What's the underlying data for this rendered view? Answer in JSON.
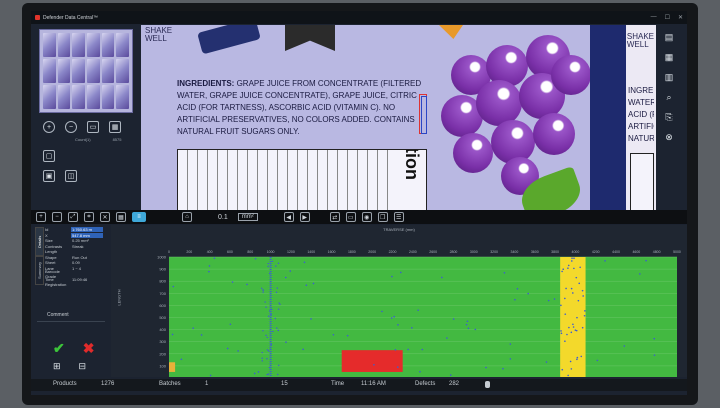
{
  "app": {
    "title": "Defender Data Central™"
  },
  "window": {
    "min": "—",
    "max": "☐",
    "close": "✕"
  },
  "label": {
    "shake_left": [
      "SHAKE",
      "WELL"
    ],
    "shake_right": [
      "SHAKE",
      "WELL"
    ],
    "ingredients_bold": "INGREDIENTS:",
    "ingredients_text": " GRAPE JUICE FROM CONCENTRATE (FILTERED WATER, GRAPE JUICE CONCENTRATE), GRAPE JUICE, CITRIC ACID (FOR TARTNESS), ASCORBIC ACID (VITAMIN C). NO ARTIFICIAL PRESERVATIVES, NO COLORS ADDED. CONTAINS NATURAL FRUIT SUGARS ONLY.",
    "right_col": [
      "INGREDIENTS",
      "WATER, GRAPE J",
      "ACID (FOR T",
      "ARTIFICIAL PRE",
      "NATURAL FRUIT"
    ],
    "nutrition_title": "Nutrition"
  },
  "left_tools": {
    "counter1": "Count(1)",
    "counter2": "8575"
  },
  "toolbar": {
    "value": "0.1",
    "unit": "mm²"
  },
  "params": [
    {
      "k": "Id",
      "v": "1:760.63 m"
    },
    {
      "k": "X",
      "v": "547.8 mm"
    },
    {
      "k": "Size",
      "v": "0.25 mm²"
    },
    {
      "k": "Contrasts",
      "v": "Streak"
    },
    {
      "k": "Length",
      "v": ""
    },
    {
      "k": "Shape",
      "v": "Run Out"
    },
    {
      "k": "Sheet",
      "v": "0.09"
    },
    {
      "k": "Lane",
      "v": "1 ~ 4"
    },
    {
      "k": "Barcode Grade",
      "v": ""
    },
    {
      "k": "Time",
      "v": "11:09:46"
    },
    {
      "k": "Registration",
      "v": ""
    }
  ],
  "tabs": [
    "Details",
    "Summary"
  ],
  "comment_label": "Comment",
  "chart_data": {
    "type": "scatter",
    "title": "TRAVERSE (mm)",
    "xlabel": "",
    "ylabel": "LENGTH",
    "xlim": [
      0,
      5000
    ],
    "ylim": [
      0,
      1000
    ],
    "yticks": [
      0,
      100,
      200,
      300,
      400,
      500,
      600,
      700,
      800,
      900,
      1000
    ],
    "xticks": [
      0,
      200,
      400,
      600,
      800,
      1000,
      1200,
      1400,
      1600,
      1800,
      2000,
      2200,
      2400,
      2600,
      2800,
      3000,
      3200,
      3400,
      3600,
      3800,
      4000,
      4200,
      4400,
      4600,
      4800,
      5000
    ],
    "background": "#43b941",
    "regions": [
      {
        "x0": 1700,
        "x1": 2300,
        "y0": 50,
        "y1": 230,
        "color": "#e52b2b"
      },
      {
        "x0": 3850,
        "x1": 4100,
        "y0": 0,
        "y1": 1000,
        "color": "#f3d92b"
      },
      {
        "x0": 0,
        "x1": 60,
        "y0": 50,
        "y1": 130,
        "color": "#e8b13a"
      }
    ],
    "streak_x": 1000,
    "point_color": "#3c5ed0"
  },
  "status": {
    "products_label": "Products",
    "products_value": "1276",
    "batches_label": "Batches",
    "batches_value": "1",
    "field_value": "15",
    "time_label": "Time",
    "time_value": "11:16 AM",
    "defects_label": "Defects",
    "defects_value": "282"
  }
}
